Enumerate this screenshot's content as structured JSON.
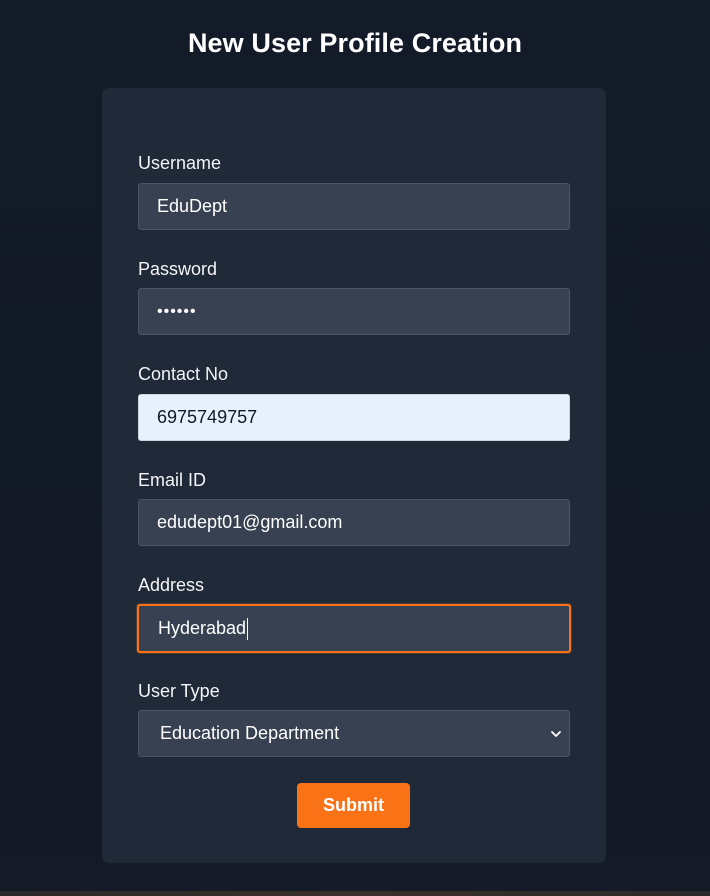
{
  "page": {
    "title": "New User Profile Creation"
  },
  "form": {
    "username": {
      "label": "Username",
      "value": "EduDept"
    },
    "password": {
      "label": "Password",
      "value": "••••••"
    },
    "contact": {
      "label": "Contact No",
      "value": "6975749757"
    },
    "email": {
      "label": "Email ID",
      "value": "edudept01@gmail.com"
    },
    "address": {
      "label": "Address",
      "value": "Hyderabad"
    },
    "user_type": {
      "label": "User Type",
      "selected": "Education Department",
      "icon": "chevron-down-icon"
    },
    "submit_label": "Submit"
  },
  "colors": {
    "accent": "#f97316",
    "card": "#1f2937",
    "field": "#374151",
    "background": "#131a27"
  }
}
